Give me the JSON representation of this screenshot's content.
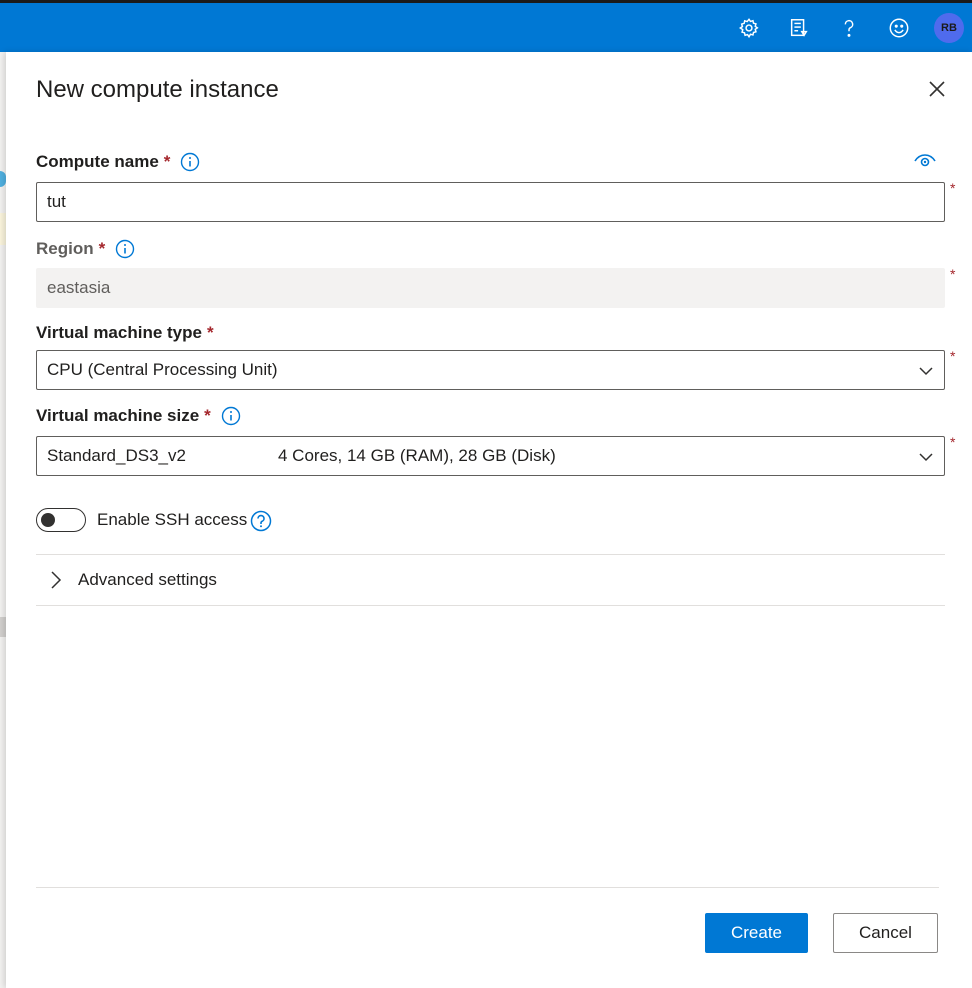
{
  "header": {
    "icons": [
      "gear-icon",
      "feedback-list-icon",
      "help-icon",
      "smiley-icon"
    ],
    "avatar_initials": "RB"
  },
  "panel": {
    "title": "New compute instance",
    "compute_name": {
      "label": "Compute name",
      "required_mark": "*",
      "value": "tut"
    },
    "region": {
      "label": "Region",
      "required_mark": "*",
      "value": "eastasia"
    },
    "vm_type": {
      "label": "Virtual machine type",
      "required_mark": "*",
      "value": "CPU (Central Processing Unit)"
    },
    "vm_size": {
      "label": "Virtual machine size",
      "required_mark": "*",
      "value": "Standard_DS3_v2",
      "spec": "4 Cores, 14 GB (RAM), 28 GB (Disk)"
    },
    "side_required_mark": "*",
    "ssh": {
      "label": "Enable SSH access",
      "enabled": false
    },
    "advanced_settings_label": "Advanced settings",
    "create_label": "Create",
    "cancel_label": "Cancel"
  },
  "colors": {
    "accent": "#0078d4",
    "required": "#a4262c",
    "avatar": "#4f6bed"
  }
}
